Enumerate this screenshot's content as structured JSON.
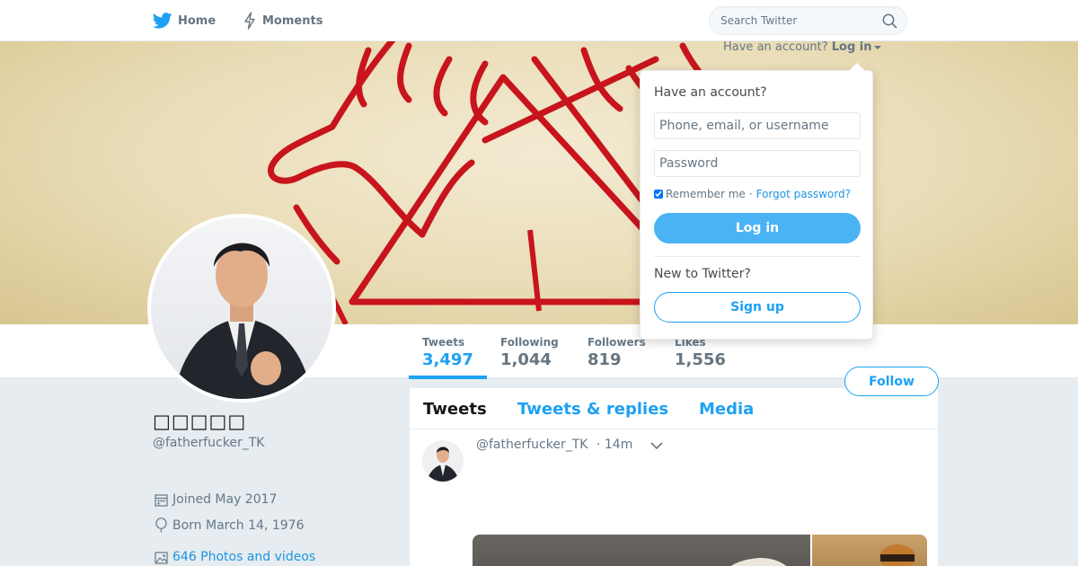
{
  "nav": {
    "home_label": "Home",
    "moments_label": "Moments",
    "search_placeholder": "Search Twitter"
  },
  "login_prompt": {
    "question": "Have an account?",
    "link_label": "Log in"
  },
  "stats": [
    {
      "label": "Tweets",
      "value": "3,497"
    },
    {
      "label": "Following",
      "value": "1,044"
    },
    {
      "label": "Followers",
      "value": "819"
    },
    {
      "label": "Likes",
      "value": "1,556"
    }
  ],
  "follow_button": "Follow",
  "profile": {
    "name": "□□□□□",
    "handle": "@fatherfucker_TK",
    "joined": "Joined May 2017",
    "born": "Born March 14, 1976",
    "photos": "646 Photos and videos"
  },
  "timeline": {
    "tabs": [
      "Tweets",
      "Tweets & replies",
      "Media"
    ],
    "tweet": {
      "handle": "@fatherfucker_TK",
      "time": "· 14m"
    }
  },
  "login_dropdown": {
    "title": "Have an account?",
    "username_placeholder": "Phone, email, or username",
    "password_placeholder": "Password",
    "remember_label": "Remember me",
    "separator": "·",
    "forgot_label": "Forgot password?",
    "login_button": "Log in",
    "new_label": "New to Twitter?",
    "signup_button": "Sign up"
  },
  "colors": {
    "accent": "#1da1f2",
    "login_button_bg": "#4ab3f4",
    "banner_logo_red": "#c8141c",
    "page_bg": "#e6ecf0"
  },
  "icons": [
    "twitter-bird-icon",
    "lightning-icon",
    "search-icon",
    "calendar-icon",
    "location-icon",
    "photo-icon",
    "chevron-down-icon"
  ]
}
